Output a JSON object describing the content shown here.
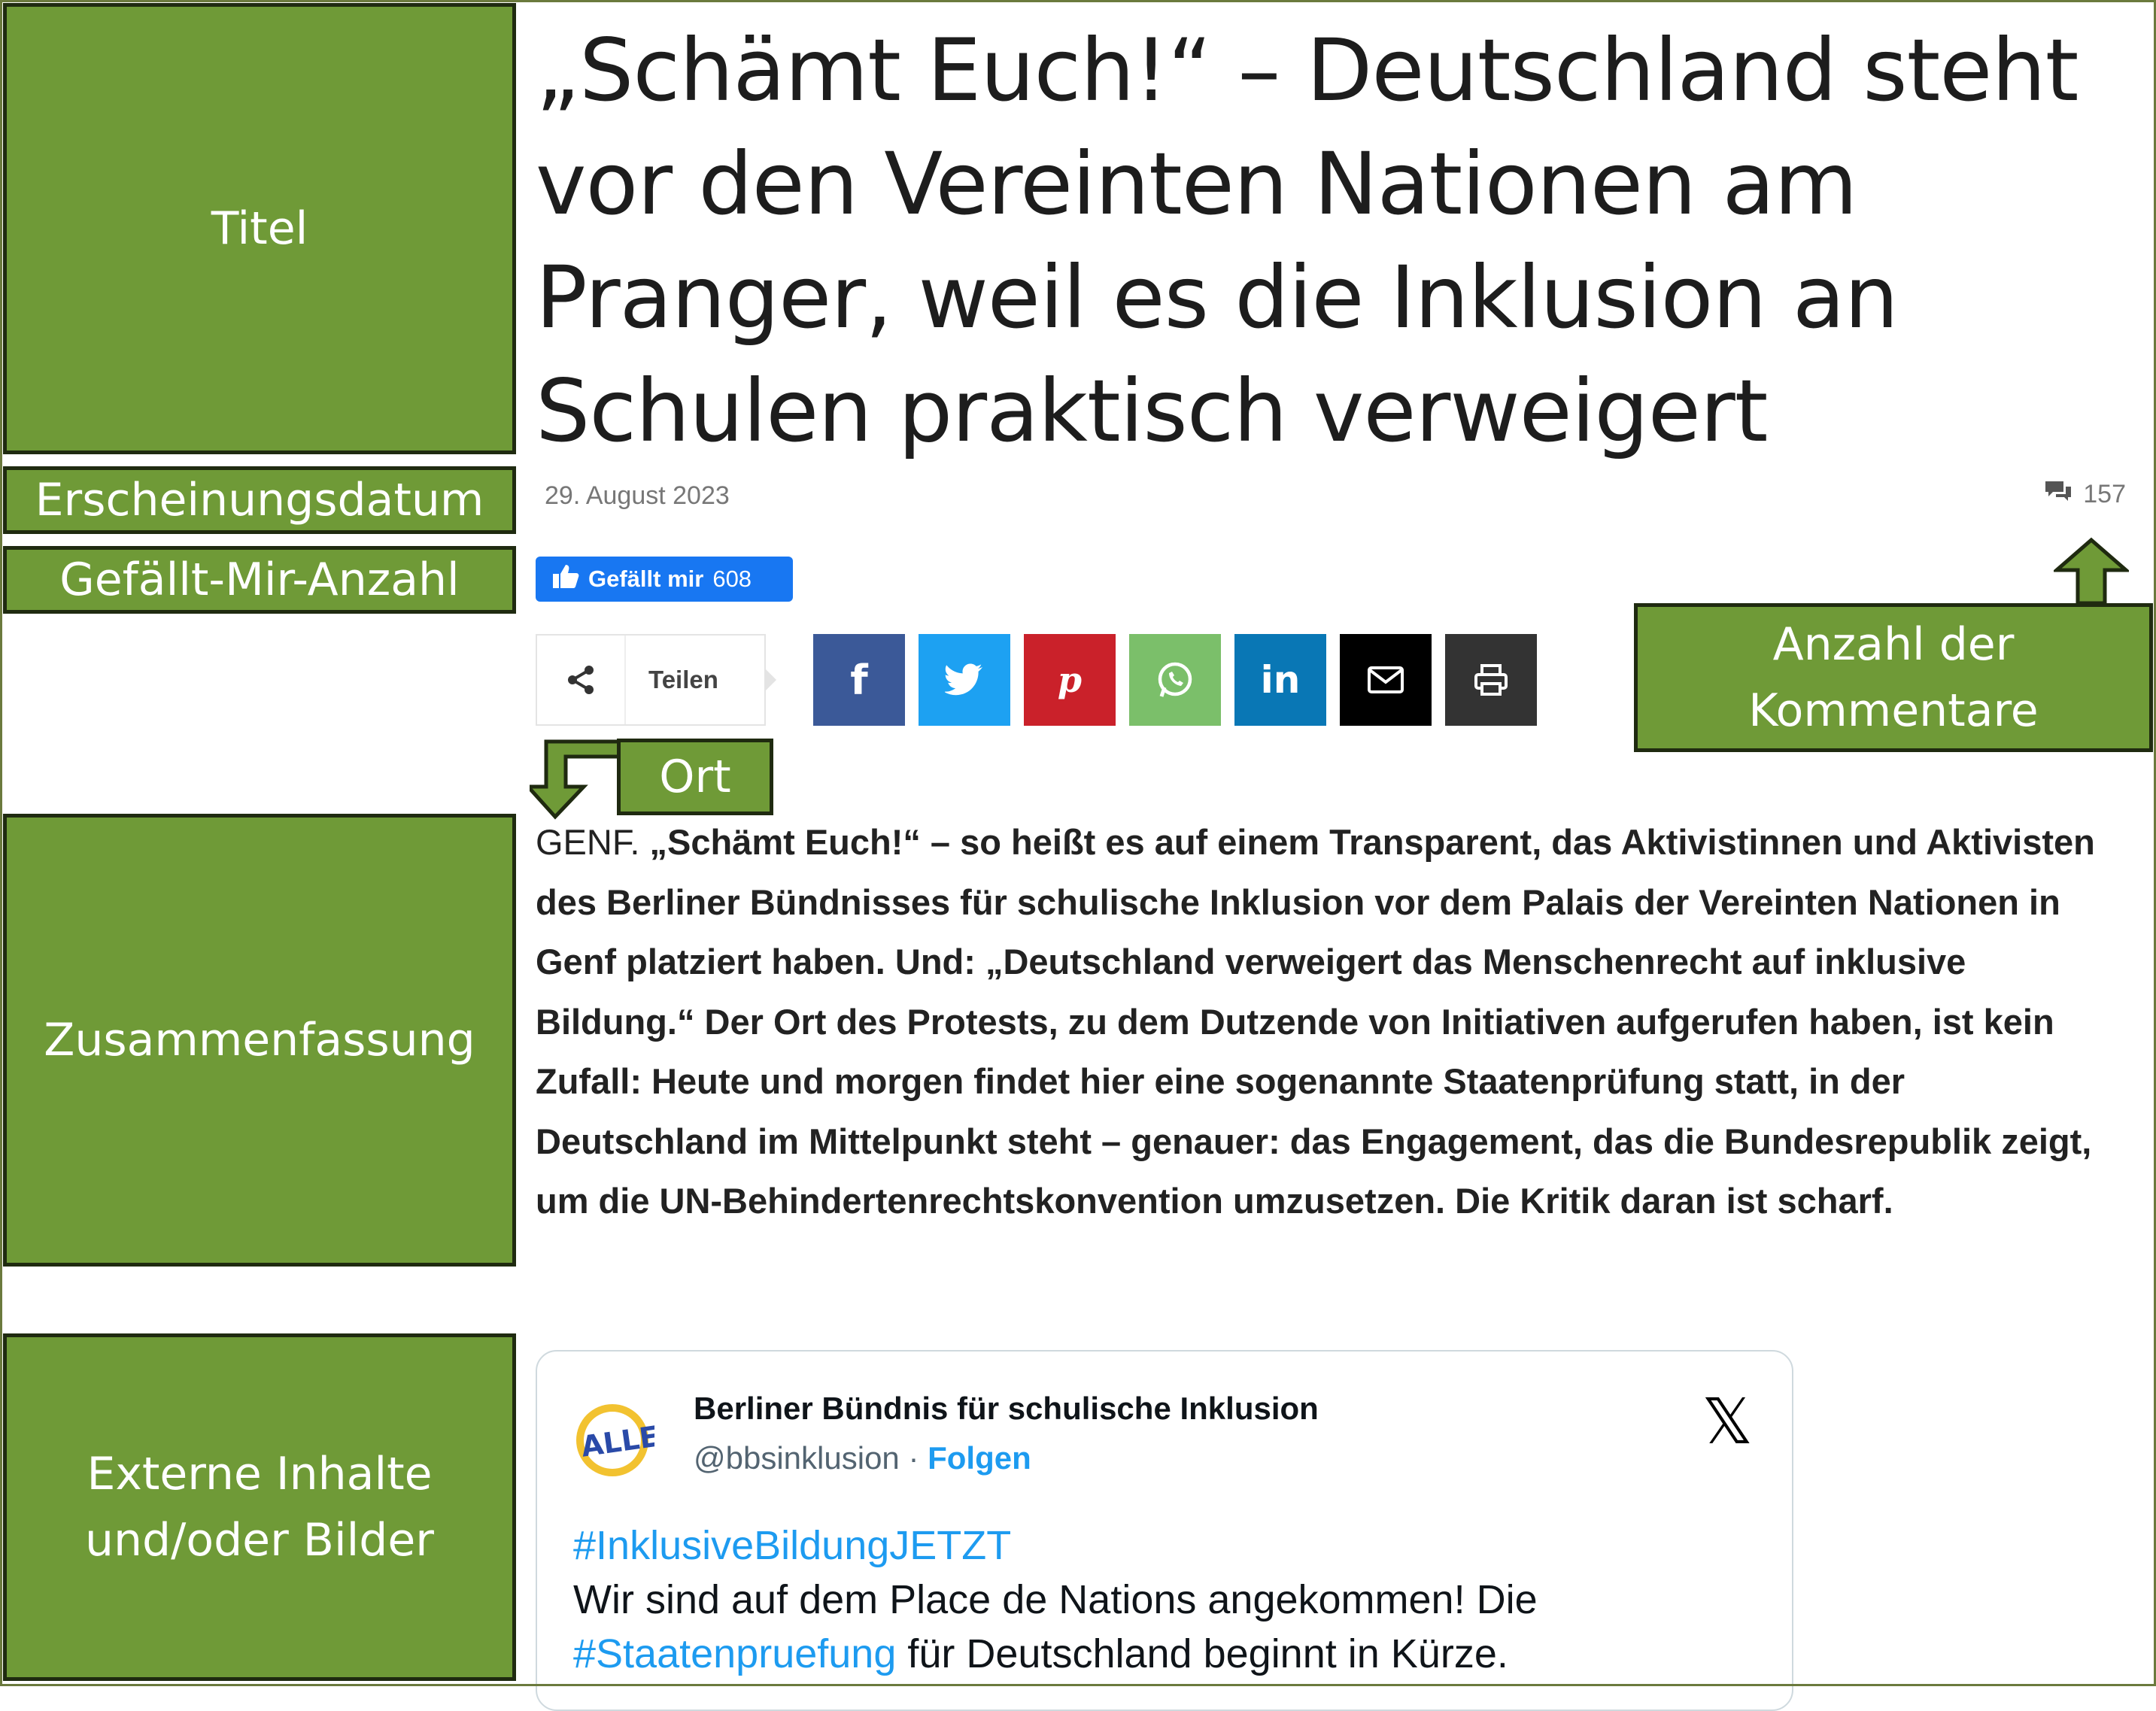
{
  "annotations": {
    "titel": "Titel",
    "erscheinungsdatum": "Erscheinungsdatum",
    "gefaellt_mir": "Gefällt-Mir-Anzahl",
    "zusammenfassung": "Zusammenfassung",
    "externe": "Externe Inhalte und/oder Bilder",
    "ort": "Ort",
    "kommentare": "Anzahl der Kommentare"
  },
  "article": {
    "title": "„Schämt Euch!“ – Deutschland steht vor den Vereinten Nationen am Pranger, weil es die Inklusion an Schulen praktisch verweigert",
    "date": "29. August 2023",
    "comment_count": "157",
    "like_label": "Gefällt mir",
    "like_count": "608",
    "share_label": "Teilen",
    "location": "GENF.",
    "lead": "„Schämt Euch!“ – so heißt es auf einem Transparent, das Aktivistinnen und Aktivisten des Berliner Bündnisses für schulische Inklusion vor dem Palais der Vereinten Nationen in Genf platziert haben. Und: „Deutschland verweigert das Menschenrecht auf inklusive Bildung.“ Der Ort des Protests, zu dem Dutzende von Initiativen aufgerufen haben, ist kein Zufall: Heute und morgen findet hier eine sogenannte Staatenprüfung statt, in der Deutschland im Mittelpunkt steht – genauer: das Engagement, das die Bundesrepublik zeigt, um die UN-Behindertenrechtskonvention umzusetzen. Die Kritik daran ist scharf."
  },
  "social_buttons": [
    {
      "name": "facebook",
      "color": "#3b5998"
    },
    {
      "name": "twitter",
      "color": "#1da1f2"
    },
    {
      "name": "pinterest",
      "color": "#ca212a"
    },
    {
      "name": "whatsapp",
      "color": "#7bbf6a"
    },
    {
      "name": "linkedin",
      "color": "#0977b5"
    },
    {
      "name": "email",
      "color": "#000000"
    },
    {
      "name": "print",
      "color": "#333333"
    }
  ],
  "tweet": {
    "author": "Berliner Bündnis für schulische Inklusion",
    "handle": "@bbsinklusion",
    "separator": "·",
    "follow": "Folgen",
    "x_glyph": "𝕏",
    "avatar_text": "ALLE",
    "hashtag1": "#InklusiveBildungJETZT",
    "line1": "Wir sind auf dem Place de Nations angekommen! Die",
    "hashtag2": "#Staatenpruefung",
    "line2": " für Deutschland beginnt in Kürze."
  },
  "colors": {
    "annotation_green": "#6f9a37",
    "facebook_blue": "#1877f2"
  }
}
